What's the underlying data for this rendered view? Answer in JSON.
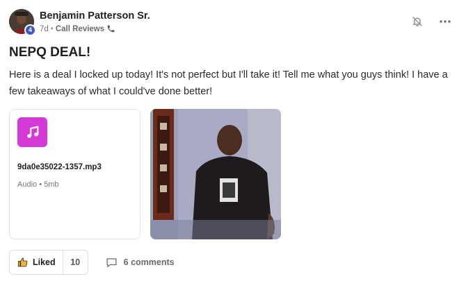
{
  "post": {
    "author": "Benjamin Patterson Sr.",
    "level": "4",
    "time_ago": "7d",
    "separator": "•",
    "category": "Call Reviews",
    "title": "NEPQ DEAL!",
    "body": "Here is a deal I locked up today! It's not perfect but I'll take it! Tell me what you guys think! I have a few takeaways of what I could've done better!"
  },
  "attachments": {
    "file": {
      "name": "9da0e35022-1357.mp3",
      "type": "Audio",
      "separator": "•",
      "size": "5mb",
      "icon": "music-note-icon"
    }
  },
  "actions": {
    "like_label": "Liked",
    "like_count": "10",
    "comments_label": "6 comments"
  },
  "colors": {
    "level_badge": "#3e58c7",
    "file_icon_bg": "#d43ad6",
    "like_icon": "#f2b233"
  }
}
